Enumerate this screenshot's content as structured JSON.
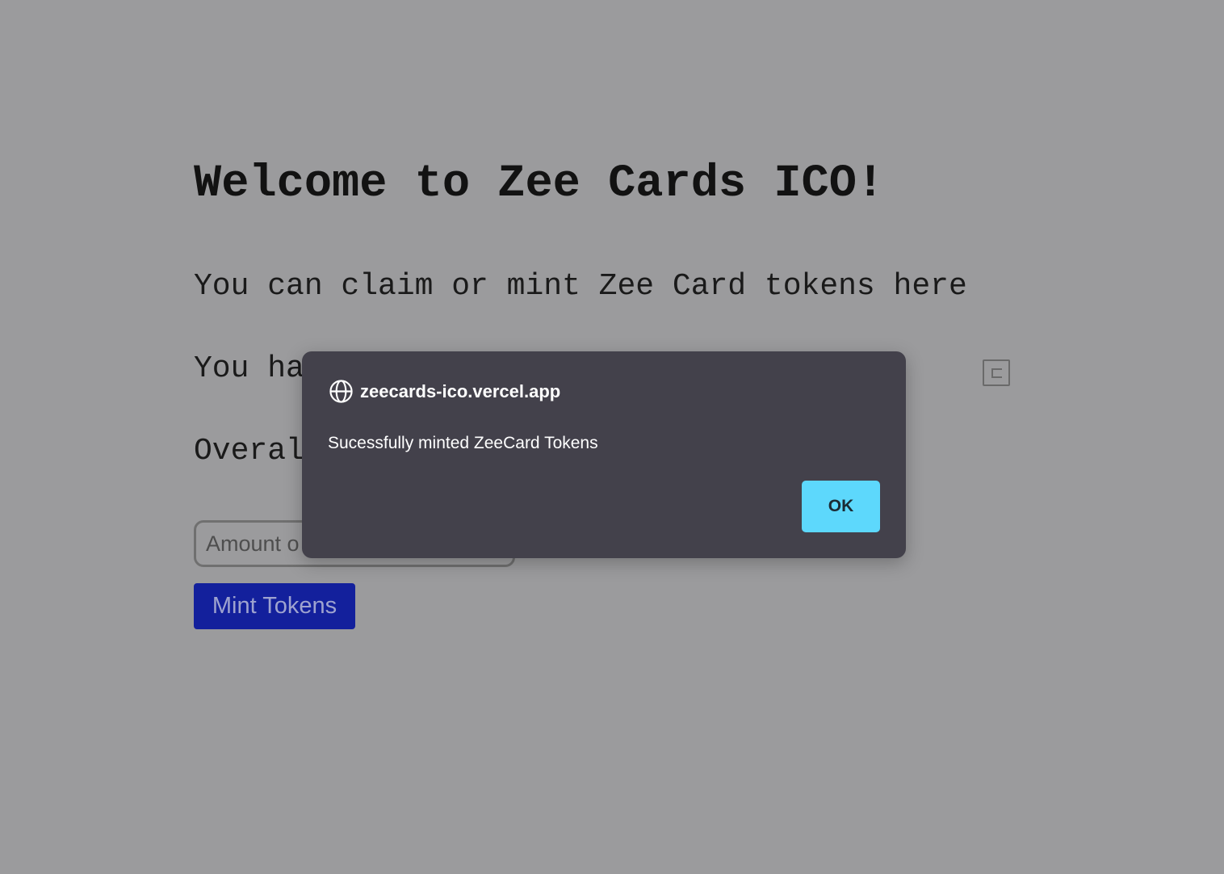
{
  "page": {
    "title": "Welcome to Zee Cards ICO!",
    "description": "You can claim or mint Zee Card tokens here",
    "balance_line_visible": "You ha",
    "overall_line_visible": "Overal"
  },
  "mint_form": {
    "amount_placeholder": "Amount o",
    "amount_value": "",
    "mint_button_label": "Mint Tokens"
  },
  "alert": {
    "origin": "zeecards-ico.vercel.app",
    "message": "Sucessfully minted ZeeCard Tokens",
    "ok_label": "OK"
  },
  "icons": {
    "alert_origin": "globe-icon",
    "copy": "copy-icon"
  },
  "colors": {
    "overlay_background": "#9b9b9d",
    "dialog_background": "#43414b",
    "ok_button": "#5dd8fc",
    "mint_button": "#13209c"
  }
}
